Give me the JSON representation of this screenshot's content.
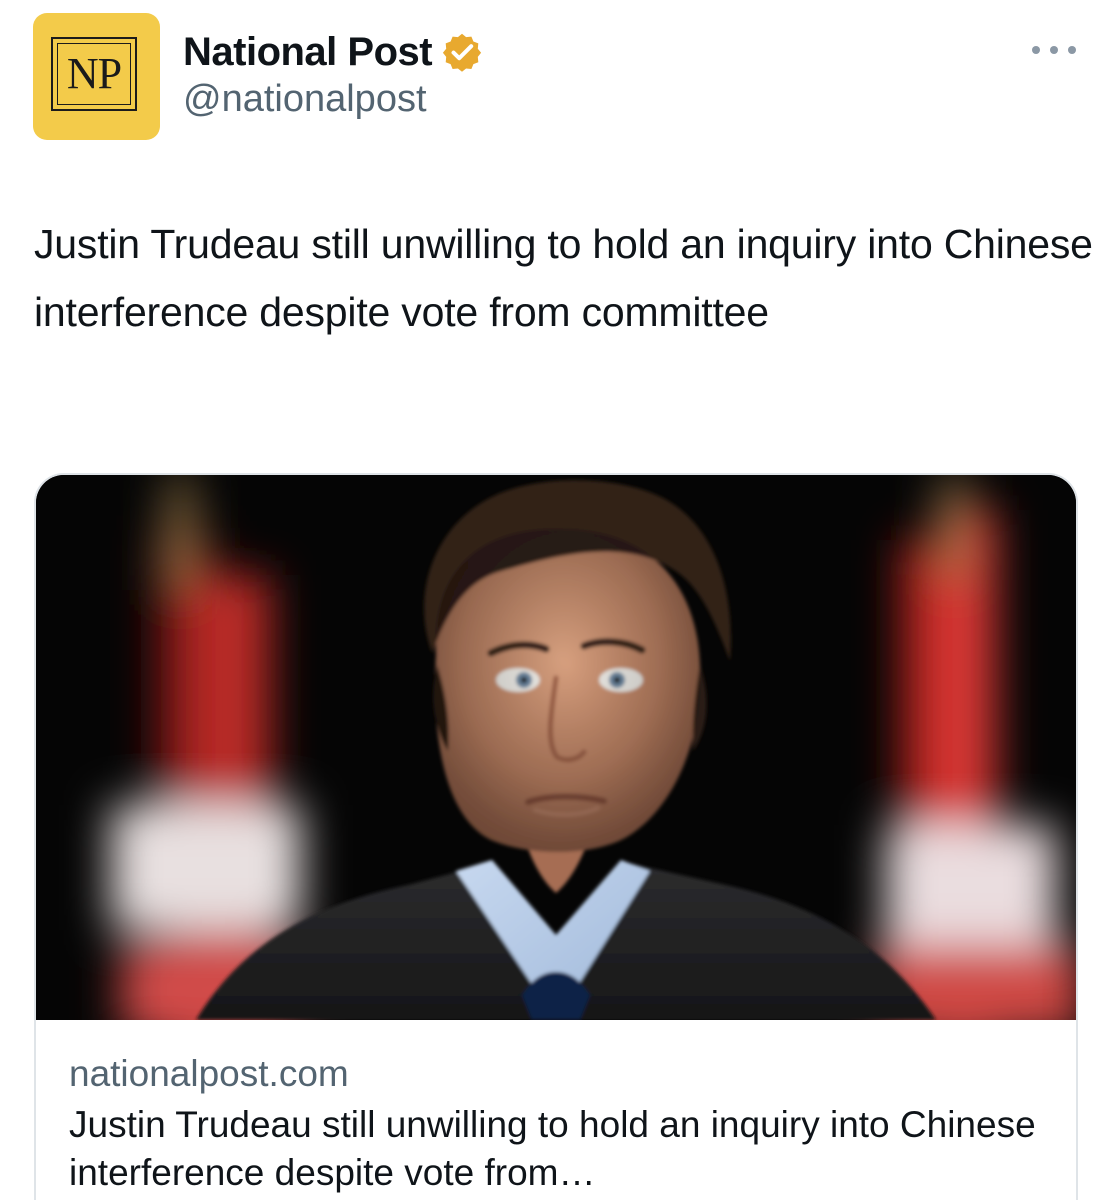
{
  "account": {
    "display_name": "National Post",
    "handle": "@nationalpost",
    "avatar_logo_text": "NP",
    "verified": true,
    "verified_color": "#e8a92f",
    "avatar_color": "#f3cb4a",
    "avatar_icon": "national-post-logo"
  },
  "menu": {
    "icon": "more-horizontal-icon"
  },
  "tweet": {
    "text": "Justin Trudeau still unwilling to hold an inquiry into Chinese interference despite vote from committee"
  },
  "link_card": {
    "image_icon": "article-photo",
    "domain": "nationalpost.com",
    "title": "Justin Trudeau still unwilling to hold an inquiry into Chinese interference despite vote from…"
  },
  "colors": {
    "text_primary": "#0f1419",
    "text_secondary": "#536471",
    "border": "#dfe4e8",
    "card_image_background": "#050505"
  }
}
